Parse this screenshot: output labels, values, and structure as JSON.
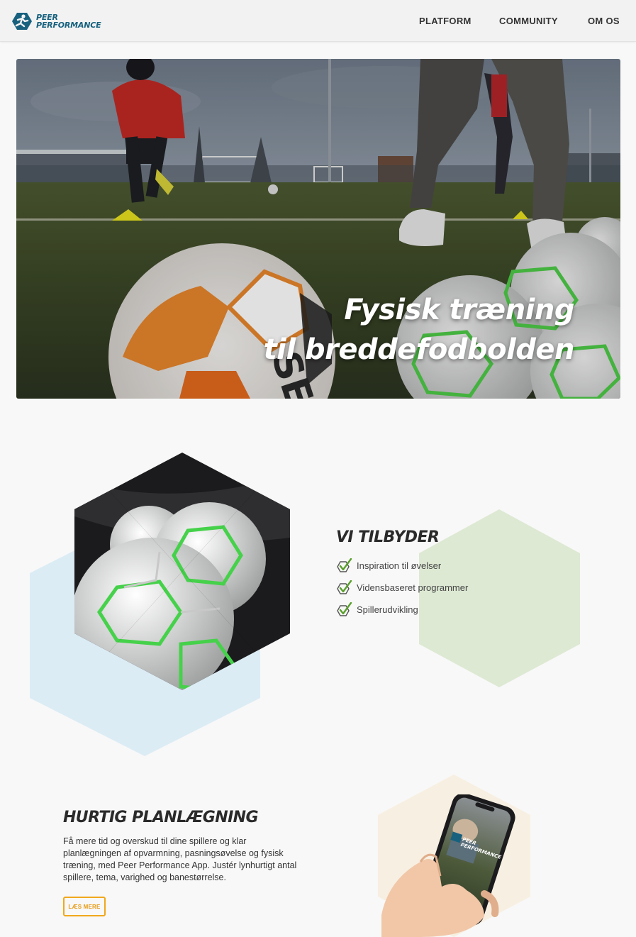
{
  "header": {
    "logo": {
      "line1": "PEER",
      "line2": "PERFORMANCE",
      "icon": "runner-hexagon-logo-icon"
    },
    "nav": [
      {
        "label": "PLATFORM"
      },
      {
        "label": "COMMUNITY"
      },
      {
        "label": "OM OS"
      }
    ]
  },
  "hero": {
    "title_line1": "Fysisk træning",
    "title_line2": "til breddefodbolden",
    "ball_brand": "SELEC"
  },
  "offer": {
    "title": "VI TILBYDER",
    "items": [
      {
        "label": "Inspiration til øvelser",
        "icon": "check-hexagon-icon"
      },
      {
        "label": "Vidensbaseret programmer",
        "icon": "check-hexagon-icon"
      },
      {
        "label": "Spillerudvikling",
        "icon": "check-hexagon-icon"
      }
    ]
  },
  "planning": {
    "title": "HURTIG PLANLÆGNING",
    "body": "Få mere tid og overskud til dine spillere og klar planlægningen af opvarmning, pasningsøvelse og fysisk træning, med Peer Performance App. Justér lynhurtigt antal spillere, tema, varighed og banestørrelse.",
    "button": "LÆS MERE",
    "phone_logo_line1": "PEER",
    "phone_logo_line2": "PERFORMANCE"
  },
  "colors": {
    "brand_blue": "#17617f",
    "accent_orange": "#f0a81c",
    "check_green": "#5aa02c",
    "hex_blue": "#dcecf5",
    "hex_green": "#dde9d3",
    "hex_cream": "#f7efe1"
  }
}
